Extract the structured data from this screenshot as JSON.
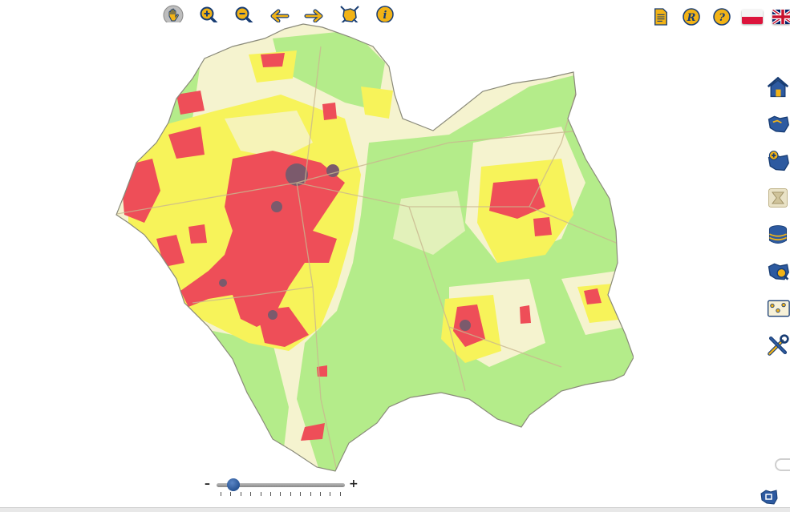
{
  "toolbar": {
    "tools": [
      {
        "id": "pan",
        "icon": "hand-icon"
      },
      {
        "id": "zoom_in",
        "icon": "zoom-in-icon"
      },
      {
        "id": "zoom_out",
        "icon": "zoom-out-icon"
      },
      {
        "id": "back",
        "icon": "arrow-left-icon"
      },
      {
        "id": "forward",
        "icon": "arrow-right-icon"
      },
      {
        "id": "full_extent",
        "icon": "full-extent-icon"
      },
      {
        "id": "info",
        "icon": "info-icon"
      }
    ],
    "info_glyph": "i"
  },
  "top_right": {
    "legend_icon": "document-icon",
    "r_glyph": "R",
    "help_glyph": "?",
    "flags": [
      "pl",
      "gb"
    ]
  },
  "sidebar": {
    "items": [
      "home-icon",
      "region-icon",
      "region-add-icon",
      "layers-icon",
      "database-icon",
      "region-search-icon",
      "points-icon",
      "tools-icon"
    ]
  },
  "map": {
    "colors": {
      "background": "#ffffff",
      "green": "#b4ec8a",
      "cream": "#f5f3cf",
      "yellow": "#f7f35a",
      "red": "#ee4e58",
      "dark": "#7b5a6c",
      "roads": "#c9b78f",
      "border": "#8a8a7a"
    }
  },
  "zoom_slider": {
    "minus": "–",
    "plus": "+",
    "level": 0.08,
    "tick_count": 13
  },
  "accent": "#f2b316",
  "navy": "#173c73"
}
